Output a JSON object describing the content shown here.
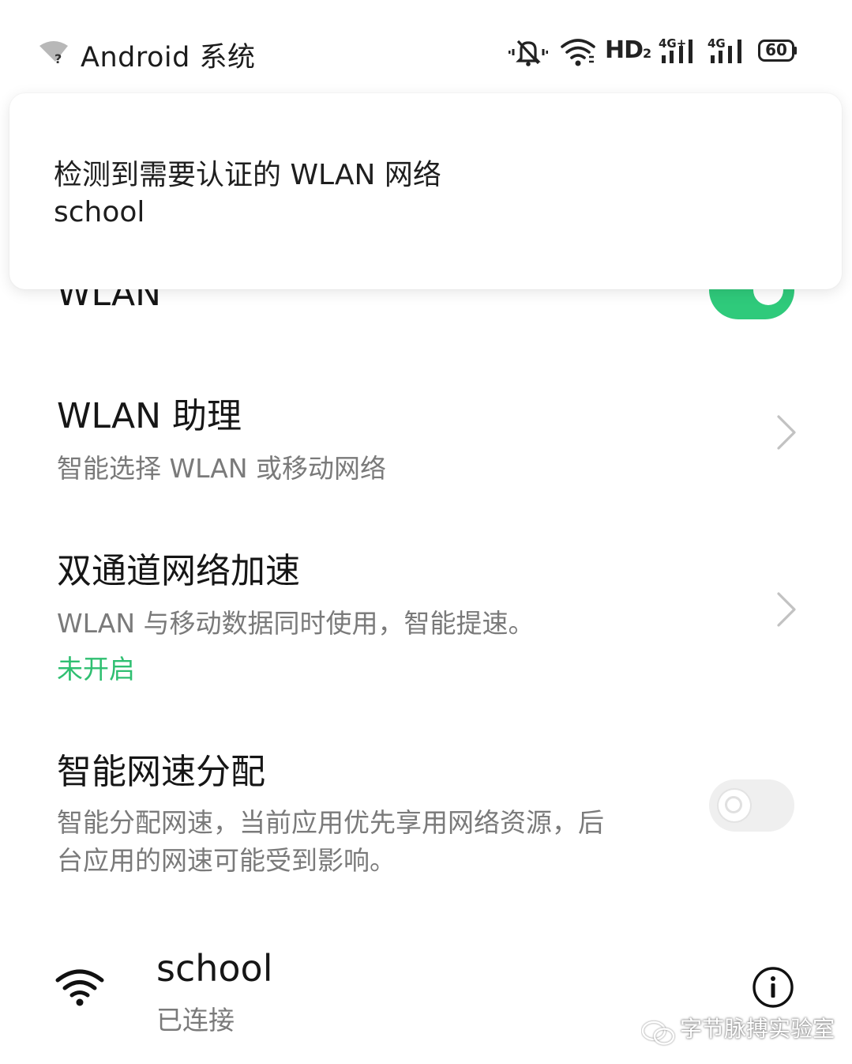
{
  "status_bar": {
    "app_name": "Android 系统",
    "hd_label": "HD",
    "hd_sub": "2",
    "signal1_label": "4G+",
    "signal2_label": "4G",
    "battery": "60"
  },
  "notification": {
    "line1": "检测到需要认证的 WLAN 网络",
    "line2": "school"
  },
  "wlan_row": {
    "title": "WLAN",
    "enabled": true
  },
  "assistant_row": {
    "title": "WLAN 助理",
    "subtitle": "智能选择 WLAN 或移动网络"
  },
  "dual_row": {
    "title": "双通道网络加速",
    "subtitle": "WLAN 与移动数据同时使用，智能提速。",
    "status": "未开启"
  },
  "speed_row": {
    "title": "智能网速分配",
    "subtitle_line1": "智能分配网速，当前应用优先享用网络资源，后",
    "subtitle_line2": "台应用的网速可能受到影响。",
    "enabled": false
  },
  "network": {
    "name": "school",
    "status": "已连接"
  },
  "watermark": {
    "text": "字节脉搏实验室"
  },
  "colors": {
    "accent": "#2fca7b",
    "status_green": "#2fbf71",
    "text": "#161616",
    "subtext": "#7a7a7a"
  }
}
